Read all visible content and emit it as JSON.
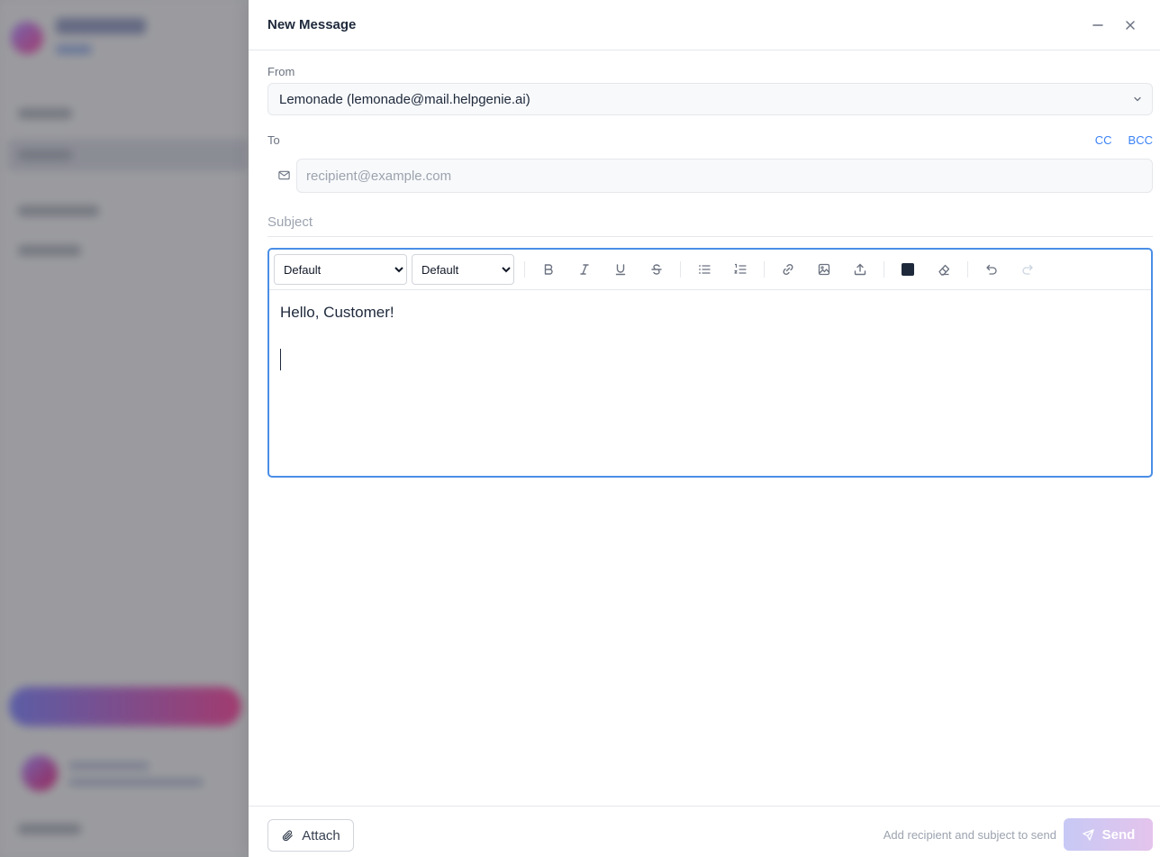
{
  "panel": {
    "title": "New Message"
  },
  "from": {
    "label": "From",
    "value": "Lemonade (lemonade@mail.helpgenie.ai)"
  },
  "to": {
    "label": "To",
    "placeholder": "recipient@example.com",
    "value": "",
    "cc_label": "CC",
    "bcc_label": "BCC"
  },
  "subject": {
    "placeholder": "Subject",
    "value": ""
  },
  "toolbar": {
    "font_family": "Default",
    "font_family_options": [
      "Default"
    ],
    "font_size": "Default",
    "font_size_options": [
      "Default"
    ],
    "text_color": "#1e293b"
  },
  "editor": {
    "body_line": "Hello, Customer!"
  },
  "footer": {
    "attach_label": "Attach",
    "hint": "Add recipient and subject to send",
    "send_label": "Send"
  },
  "colors": {
    "accent": "#4a8ee6",
    "link": "#3b82f6",
    "send_gradient_start": "#c7c9f5",
    "send_gradient_end": "#e4c4ec"
  }
}
